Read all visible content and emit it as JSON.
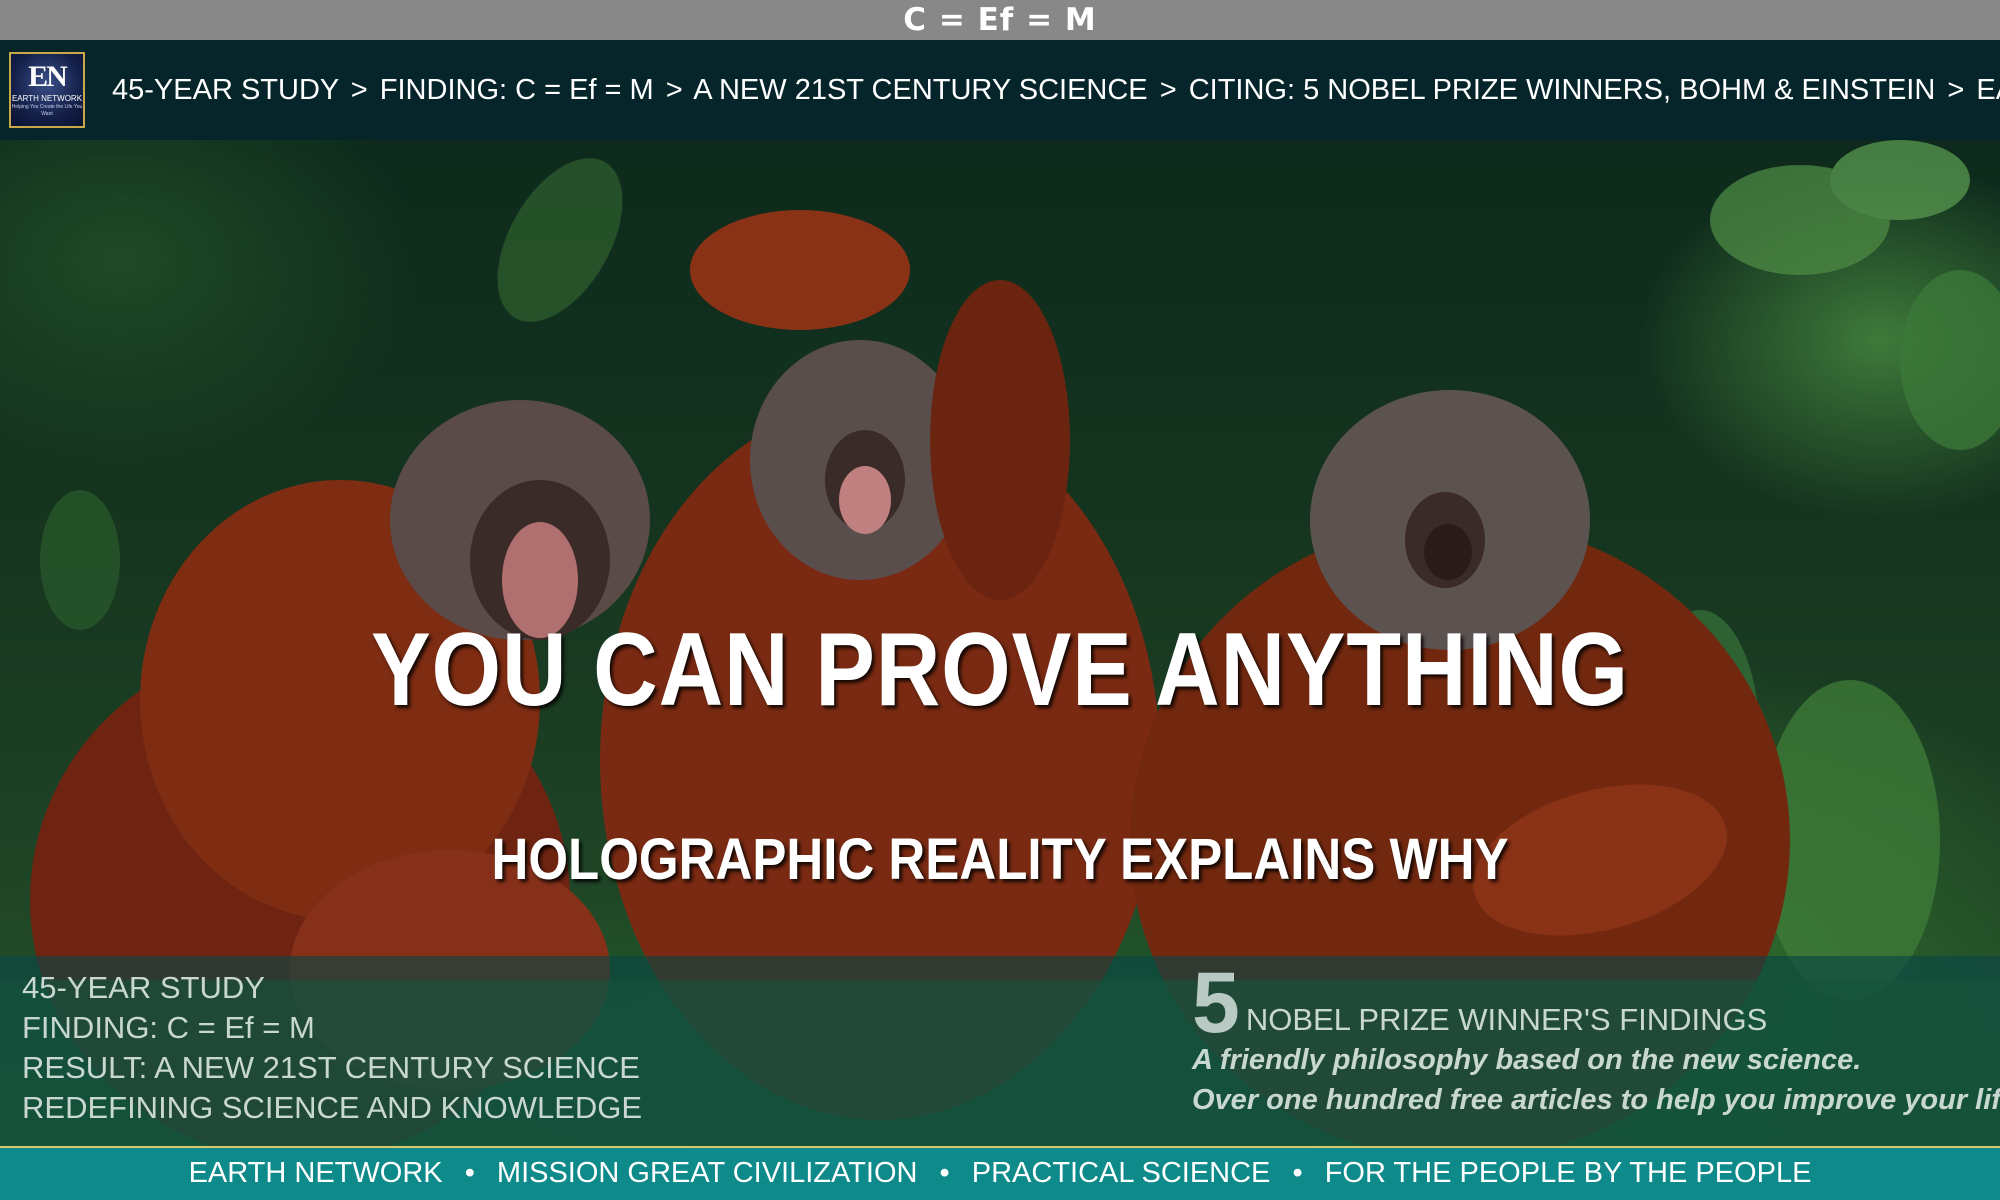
{
  "top_title": "C = Ef = M",
  "logo": {
    "mark": "EN",
    "name": "EARTH NETWORK",
    "tagline": "Helping You Create the Life You Want"
  },
  "breadcrumb": [
    "45-YEAR STUDY",
    "FINDING: C = Ef = M",
    "A NEW 21ST CENTURY SCIENCE",
    "CITING: 5 NOBEL PRIZE WINNERS, BOHM & EINSTEIN",
    "EASTWOOD"
  ],
  "breadcrumb_separator": ">",
  "hero": {
    "heading": "YOU CAN PROVE ANYTHING",
    "subheading": "HOLOGRAPHIC REALITY EXPLAINS WHY"
  },
  "info_left": [
    "45-YEAR STUDY",
    "FINDING: C = Ef = M",
    "RESULT: A NEW 21ST CENTURY SCIENCE",
    "REDEFINING SCIENCE AND KNOWLEDGE"
  ],
  "info_right": {
    "number": "5",
    "label": "NOBEL PRIZE WINNER'S FINDINGS",
    "tagline_1": "A friendly philosophy based on the new science.",
    "tagline_2": "Over one hundred free articles to help you improve your life"
  },
  "footer": {
    "items": [
      "EARTH NETWORK",
      "MISSION GREAT CIVILIZATION",
      "PRACTICAL SCIENCE",
      "FOR THE PEOPLE BY THE PEOPLE"
    ],
    "separator": "•"
  },
  "colors": {
    "title_bar": "#888888",
    "nav_bar": "#05252a",
    "footer": "#0f8a8a",
    "footer_border": "#d8c86a",
    "orangutan_fur": "#8a2e12"
  }
}
